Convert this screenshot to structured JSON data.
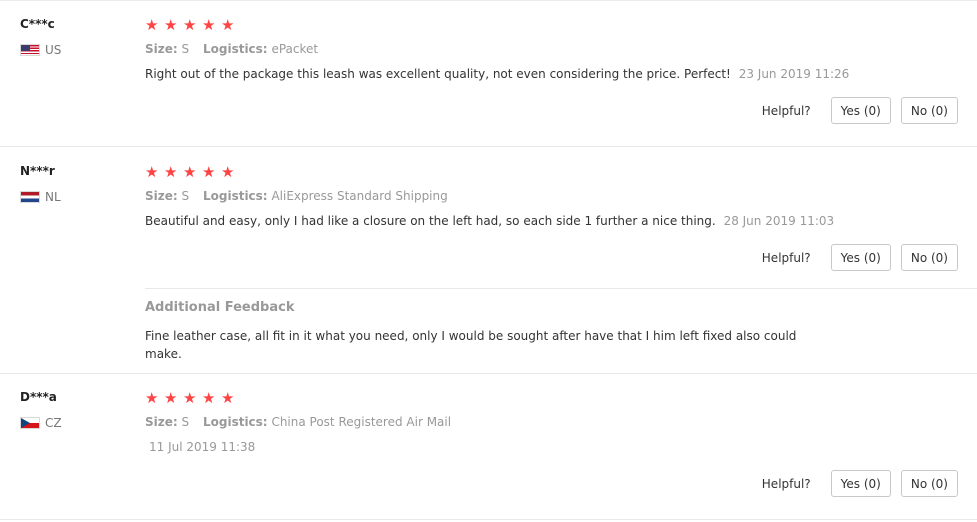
{
  "reviews": [
    {
      "user": "C***c",
      "country": "US",
      "rating": 5,
      "size_label": "Size:",
      "size": "S",
      "logistics_label": "Logistics:",
      "logistics": "ePacket",
      "text": "Right out of the package this leash was excellent quality, not even considering the price. Perfect!",
      "date": "23 Jun 2019 11:26",
      "helpful_label": "Helpful?",
      "yes_label": "Yes (0)",
      "no_label": "No (0)"
    },
    {
      "user": "N***r",
      "country": "NL",
      "rating": 5,
      "size_label": "Size:",
      "size": "S",
      "logistics_label": "Logistics:",
      "logistics": "AliExpress Standard Shipping",
      "text": "Beautiful and easy, only I had like a closure on the left had, so each side 1 further a nice thing.",
      "date": "28 Jun 2019 11:03",
      "helpful_label": "Helpful?",
      "yes_label": "Yes (0)",
      "no_label": "No (0)",
      "additional_title": "Additional Feedback",
      "additional_text": "Fine leather case, all fit in it what you need, only I would be sought after have that I him left fixed also could make."
    },
    {
      "user": "D***a",
      "country": "CZ",
      "rating": 5,
      "size_label": "Size:",
      "size": "S",
      "logistics_label": "Logistics:",
      "logistics": "China Post Registered Air Mail",
      "text": "",
      "date": "11 Jul 2019 11:38",
      "helpful_label": "Helpful?",
      "yes_label": "Yes (0)",
      "no_label": "No (0)"
    }
  ],
  "colors": {
    "star": "#ff4444",
    "muted": "#999999",
    "text": "#333333"
  },
  "icons": {
    "star": "star-icon",
    "flag_us": "flag-us-icon",
    "flag_nl": "flag-nl-icon",
    "flag_cz": "flag-cz-icon"
  }
}
